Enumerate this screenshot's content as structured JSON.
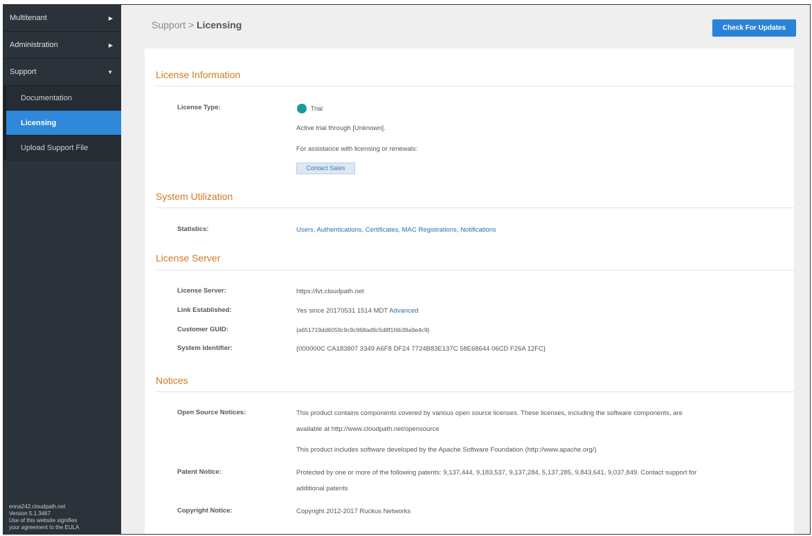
{
  "sidebar": {
    "items": [
      {
        "label": "Multitenant",
        "caret": "▶"
      },
      {
        "label": "Administration",
        "caret": "▶"
      },
      {
        "label": "Support",
        "caret": "▼"
      }
    ],
    "subitems": [
      {
        "label": "Documentation"
      },
      {
        "label": "Licensing"
      },
      {
        "label": "Upload Support File"
      }
    ],
    "footer": {
      "host": "enna242.cloudpath.net",
      "version": "Version 5.1.3467",
      "eula_line1": "Use of this website signifies",
      "eula_line2": "your agreement to the EULA"
    }
  },
  "header": {
    "crumb_parent": "Support",
    "separator": ">",
    "crumb_current": "Licensing",
    "update_button": "Check For Updates"
  },
  "license_info": {
    "title": "License Information",
    "type_label": "License Type:",
    "type_value": "Trial",
    "active_text": "Active trial through [Unknown].",
    "assist_text": "For assistance with licensing or renewals:",
    "contact_button": "Contact Sales"
  },
  "utilization": {
    "title": "System Utilization",
    "stats_label": "Statistics:",
    "stats_links": "Users, Authentications, Certificates, MAC Registrations, Notifications"
  },
  "license_server": {
    "title": "License Server",
    "server_label": "License Server:",
    "server_value": "https://lvt.cloudpath.net",
    "link_label": "Link Established:",
    "link_value": "Yes since 20170531 1514 MDT",
    "link_advanced": "Advanced",
    "guid_label": "Customer GUID:",
    "guid_value": "{a651719dd6059c9c9c968ad9c5d8f1f4b39a9e4c9}",
    "sysid_label": "System Identifier:",
    "sysid_value": "{000000C CA183807 3349 A6F8 DF24 7724B83E137C 58E68644 06CD F26A 12FC}"
  },
  "notices": {
    "title": "Notices",
    "oss_label": "Open Source Notices:",
    "oss_line1": "This product contains components covered by various open source licenses. These licenses, including the software components, are",
    "oss_line2": "available at http://www.cloudpath.net/opensource",
    "apache_line": "This product includes software developed by the Apache Software Foundation (http://www.apache.org/)",
    "patent_label": "Patent Notice:",
    "patent_line1": "Protected by one or more of the following patents: 9,137,444, 9,183,537, 9,137,284, 5,137,285, 9,843,641, 9,037,849. Contact support for",
    "patent_line2": "additional patents",
    "copyright_label": "Copyright Notice:",
    "copyright_value": "Copyright 2012-2017 Ruckus Networks"
  }
}
